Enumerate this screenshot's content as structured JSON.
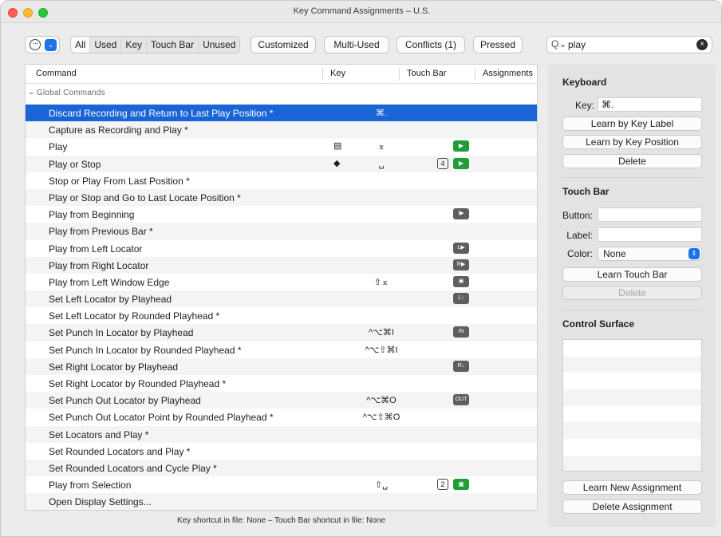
{
  "window": {
    "title": "Key Command Assignments – U.S."
  },
  "toolbar": {
    "filters": [
      "All",
      "Used",
      "Key",
      "Touch Bar",
      "Unused"
    ],
    "customized": "Customized",
    "multi_used": "Multi-Used",
    "conflicts": "Conflicts (1)",
    "pressed": "Pressed",
    "search_value": "play"
  },
  "table": {
    "headers": {
      "command": "Command",
      "key": "Key",
      "touch_bar": "Touch Bar",
      "assignments": "Assignments"
    },
    "group": "Global Commands",
    "rows": [
      {
        "command": "Discard Recording and Return to Last Play Position *",
        "key_icon": "",
        "key": "⌘.",
        "tb_num": "",
        "tb_icon": "",
        "selected": true
      },
      {
        "command": "Capture as Recording and Play *",
        "key_icon": "",
        "key": "",
        "tb_num": "",
        "tb_icon": ""
      },
      {
        "command": "Play",
        "key_icon": "▤",
        "key": "⌅",
        "tb_num": "",
        "tb_icon": "▶"
      },
      {
        "command": "Play or Stop",
        "key_icon": "◆",
        "key": "␣",
        "tb_num": "4",
        "tb_icon": "▶"
      },
      {
        "command": "Stop or Play From Last Position *",
        "key_icon": "",
        "key": "",
        "tb_num": "",
        "tb_icon": ""
      },
      {
        "command": "Play or Stop and Go to Last Locate Position *",
        "key_icon": "",
        "key": "",
        "tb_num": "",
        "tb_icon": ""
      },
      {
        "command": "Play from Beginning",
        "key_icon": "",
        "key": "",
        "tb_num": "",
        "tb_icon": "I▶"
      },
      {
        "command": "Play from Previous Bar *",
        "key_icon": "",
        "key": "",
        "tb_num": "",
        "tb_icon": ""
      },
      {
        "command": "Play from Left Locator",
        "key_icon": "",
        "key": "",
        "tb_num": "",
        "tb_icon": "L▶"
      },
      {
        "command": "Play from Right Locator",
        "key_icon": "",
        "key": "",
        "tb_num": "",
        "tb_icon": "R▶"
      },
      {
        "command": "Play from Left Window Edge",
        "key_icon": "",
        "key": "⇧⌅",
        "tb_num": "",
        "tb_icon": "▣"
      },
      {
        "command": "Set Left Locator by Playhead",
        "key_icon": "",
        "key": "",
        "tb_num": "",
        "tb_icon": "L↓"
      },
      {
        "command": "Set Left Locator by Rounded Playhead *",
        "key_icon": "",
        "key": "",
        "tb_num": "",
        "tb_icon": ""
      },
      {
        "command": "Set Punch In Locator by Playhead",
        "key_icon": "",
        "key": "^⌥⌘I",
        "tb_num": "",
        "tb_icon": "IN"
      },
      {
        "command": "Set Punch In Locator by Rounded Playhead *",
        "key_icon": "",
        "key": "^⌥⇧⌘I",
        "tb_num": "",
        "tb_icon": ""
      },
      {
        "command": "Set Right Locator by Playhead",
        "key_icon": "",
        "key": "",
        "tb_num": "",
        "tb_icon": "R↓"
      },
      {
        "command": "Set Right Locator by Rounded Playhead *",
        "key_icon": "",
        "key": "",
        "tb_num": "",
        "tb_icon": ""
      },
      {
        "command": "Set Punch Out Locator by Playhead",
        "key_icon": "",
        "key": "^⌥⌘O",
        "tb_num": "",
        "tb_icon": "OUT"
      },
      {
        "command": "Set Punch Out Locator Point by Rounded Playhead *",
        "key_icon": "",
        "key": "^⌥⇧⌘O",
        "tb_num": "",
        "tb_icon": ""
      },
      {
        "command": "Set Locators and Play *",
        "key_icon": "",
        "key": "",
        "tb_num": "",
        "tb_icon": ""
      },
      {
        "command": "Set Rounded Locators and Play *",
        "key_icon": "",
        "key": "",
        "tb_num": "",
        "tb_icon": ""
      },
      {
        "command": "Set Rounded Locators and Cycle Play *",
        "key_icon": "",
        "key": "",
        "tb_num": "",
        "tb_icon": ""
      },
      {
        "command": "Play from Selection",
        "key_icon": "",
        "key": "⇧␣",
        "tb_num": "2",
        "tb_icon": "▣"
      },
      {
        "command": "Open Display Settings...",
        "key_icon": "",
        "key": "",
        "tb_num": "",
        "tb_icon": ""
      }
    ]
  },
  "status_text": "Key shortcut in file: None – Touch Bar shortcut in file: None",
  "panel": {
    "keyboard_header": "Keyboard",
    "key_label": "Key:",
    "key_value": "⌘.",
    "learn_by_key_label": "Learn by Key Label",
    "learn_by_key_position": "Learn by Key Position",
    "delete": "Delete",
    "touchbar_header": "Touch Bar",
    "button_label": "Button:",
    "label_label": "Label:",
    "color_label": "Color:",
    "color_value": "None",
    "learn_touch_bar": "Learn Touch Bar",
    "delete_touchbar": "Delete",
    "control_surface_header": "Control Surface",
    "learn_new_assignment": "Learn New Assignment",
    "delete_assignment": "Delete Assignment"
  },
  "colors": {
    "selection": "#1a64d6",
    "touchbar_green": "#1f9d36",
    "accent": "#1a73e8"
  }
}
